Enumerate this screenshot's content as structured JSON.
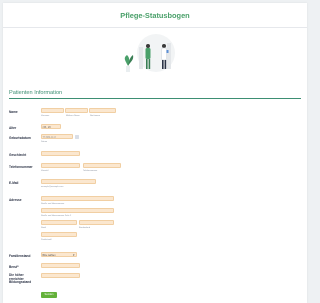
{
  "form": {
    "title": "Pflege-Statusbogen",
    "section_title": "Patienten Information",
    "submit_label": "Senden"
  },
  "fields": {
    "name": {
      "label": "Name",
      "sub": [
        "Vorname",
        "Mittlerer Name",
        "Nachname"
      ]
    },
    "alter": {
      "label": "Alter",
      "value": "z.B., 23"
    },
    "geburtsdatum": {
      "label": "Geburtsdatum",
      "placeholder": "TT-MM-JJJJ",
      "sub": "Datum"
    },
    "geschlecht": {
      "label": "Geschlecht"
    },
    "telefon": {
      "label": "Telefonnummer",
      "sub": [
        "Vorwahl",
        "Telefonnummer"
      ]
    },
    "email": {
      "label": "E-Mail",
      "sub": "example@example.com"
    },
    "adresse": {
      "label": "Adresse",
      "sub": [
        "Straße und Hausnummer",
        "Straße und Hausnummer Zeile 2",
        "Stadt",
        "Bundesland",
        "Postleitzahl"
      ]
    },
    "familienstand": {
      "label": "Familienstand",
      "value": "Bitte wählen"
    },
    "beruf": {
      "label": "Beruf*"
    },
    "bildung": {
      "label": "Die höher erreichter Bildungsstand"
    }
  }
}
